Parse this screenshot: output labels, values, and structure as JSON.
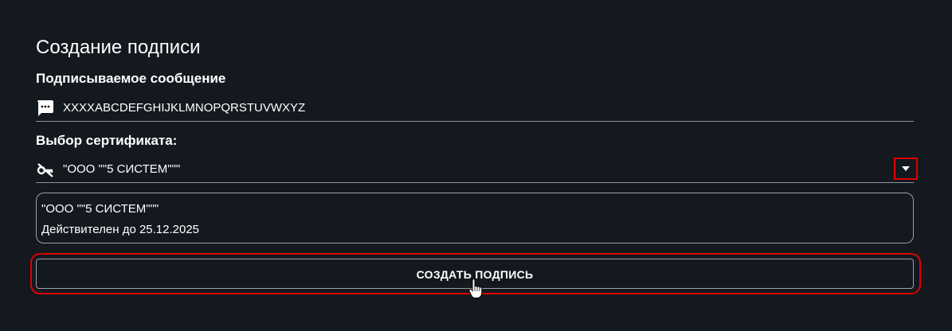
{
  "page": {
    "title": "Создание подписи"
  },
  "message": {
    "label": "Подписываемое сообщение",
    "value": "XXXXABCDEFGHIJKLMNOPQRSTUVWXYZ",
    "icon": "message-icon"
  },
  "certificate": {
    "label": "Выбор сертификата:",
    "selected": "\"ООО \"\"5 СИСТЕМ\"\"\"",
    "icon": "key-off-icon",
    "dropdown_icon": "triangle-down-icon",
    "card": {
      "name": "\"ООО \"\"5 СИСТЕМ\"\"\"",
      "validity": "Действителен до 25.12.2025"
    }
  },
  "actions": {
    "create_label": "СОЗДАТЬ ПОДПИСЬ"
  },
  "colors": {
    "background": "#14181f",
    "text": "#ffffff",
    "border": "#9ba0a8",
    "highlight": "#e00000"
  }
}
